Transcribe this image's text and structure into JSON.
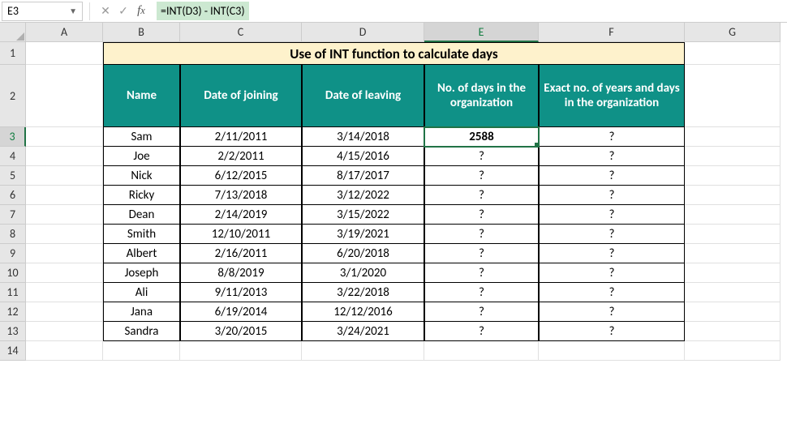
{
  "nameBox": "E3",
  "formula": "=INT(D3) - INT(C3)",
  "columns": [
    "A",
    "B",
    "C",
    "D",
    "E",
    "F",
    "G"
  ],
  "rows": [
    "1",
    "2",
    "3",
    "4",
    "5",
    "6",
    "7",
    "8",
    "9",
    "10",
    "11",
    "12",
    "13",
    "14"
  ],
  "title": "Use of INT function to calculate days",
  "headers": {
    "name": "Name",
    "joining": "Date of joining",
    "leaving": "Date of leaving",
    "days": "No. of days in the organization",
    "years": "Exact no. of years and days in the organization"
  },
  "data": [
    {
      "name": "Sam",
      "joining": "2/11/2011",
      "leaving": "3/14/2018",
      "days": "2588",
      "years": "?"
    },
    {
      "name": "Joe",
      "joining": "2/2/2011",
      "leaving": "4/15/2016",
      "days": "?",
      "years": "?"
    },
    {
      "name": "Nick",
      "joining": "6/12/2015",
      "leaving": "8/17/2017",
      "days": "?",
      "years": "?"
    },
    {
      "name": "Ricky",
      "joining": "7/13/2018",
      "leaving": "3/12/2022",
      "days": "?",
      "years": "?"
    },
    {
      "name": "Dean",
      "joining": "2/14/2019",
      "leaving": "3/15/2022",
      "days": "?",
      "years": "?"
    },
    {
      "name": "Smith",
      "joining": "12/10/2011",
      "leaving": "3/19/2021",
      "days": "?",
      "years": "?"
    },
    {
      "name": "Albert",
      "joining": "2/16/2011",
      "leaving": "6/20/2018",
      "days": "?",
      "years": "?"
    },
    {
      "name": "Joseph",
      "joining": "8/8/2019",
      "leaving": "3/1/2020",
      "days": "?",
      "years": "?"
    },
    {
      "name": "Ali",
      "joining": "9/11/2013",
      "leaving": "3/22/2018",
      "days": "?",
      "years": "?"
    },
    {
      "name": "Jana",
      "joining": "6/19/2014",
      "leaving": "12/12/2016",
      "days": "?",
      "years": "?"
    },
    {
      "name": "Sandra",
      "joining": "3/20/2015",
      "leaving": "3/24/2021",
      "days": "?",
      "years": "?"
    }
  ],
  "selectedCell": "E3",
  "chart_data": {
    "type": "table",
    "title": "Use of INT function to calculate days",
    "columns": [
      "Name",
      "Date of joining",
      "Date of leaving",
      "No. of days in the organization",
      "Exact no. of years and days in the organization"
    ],
    "rows": [
      [
        "Sam",
        "2/11/2011",
        "3/14/2018",
        "2588",
        "?"
      ],
      [
        "Joe",
        "2/2/2011",
        "4/15/2016",
        "?",
        "?"
      ],
      [
        "Nick",
        "6/12/2015",
        "8/17/2017",
        "?",
        "?"
      ],
      [
        "Ricky",
        "7/13/2018",
        "3/12/2022",
        "?",
        "?"
      ],
      [
        "Dean",
        "2/14/2019",
        "3/15/2022",
        "?",
        "?"
      ],
      [
        "Smith",
        "12/10/2011",
        "3/19/2021",
        "?",
        "?"
      ],
      [
        "Albert",
        "2/16/2011",
        "6/20/2018",
        "?",
        "?"
      ],
      [
        "Joseph",
        "8/8/2019",
        "3/1/2020",
        "?",
        "?"
      ],
      [
        "Ali",
        "9/11/2013",
        "3/22/2018",
        "?",
        "?"
      ],
      [
        "Jana",
        "6/19/2014",
        "12/12/2016",
        "?",
        "?"
      ],
      [
        "Sandra",
        "3/20/2015",
        "3/24/2021",
        "?",
        "?"
      ]
    ]
  }
}
